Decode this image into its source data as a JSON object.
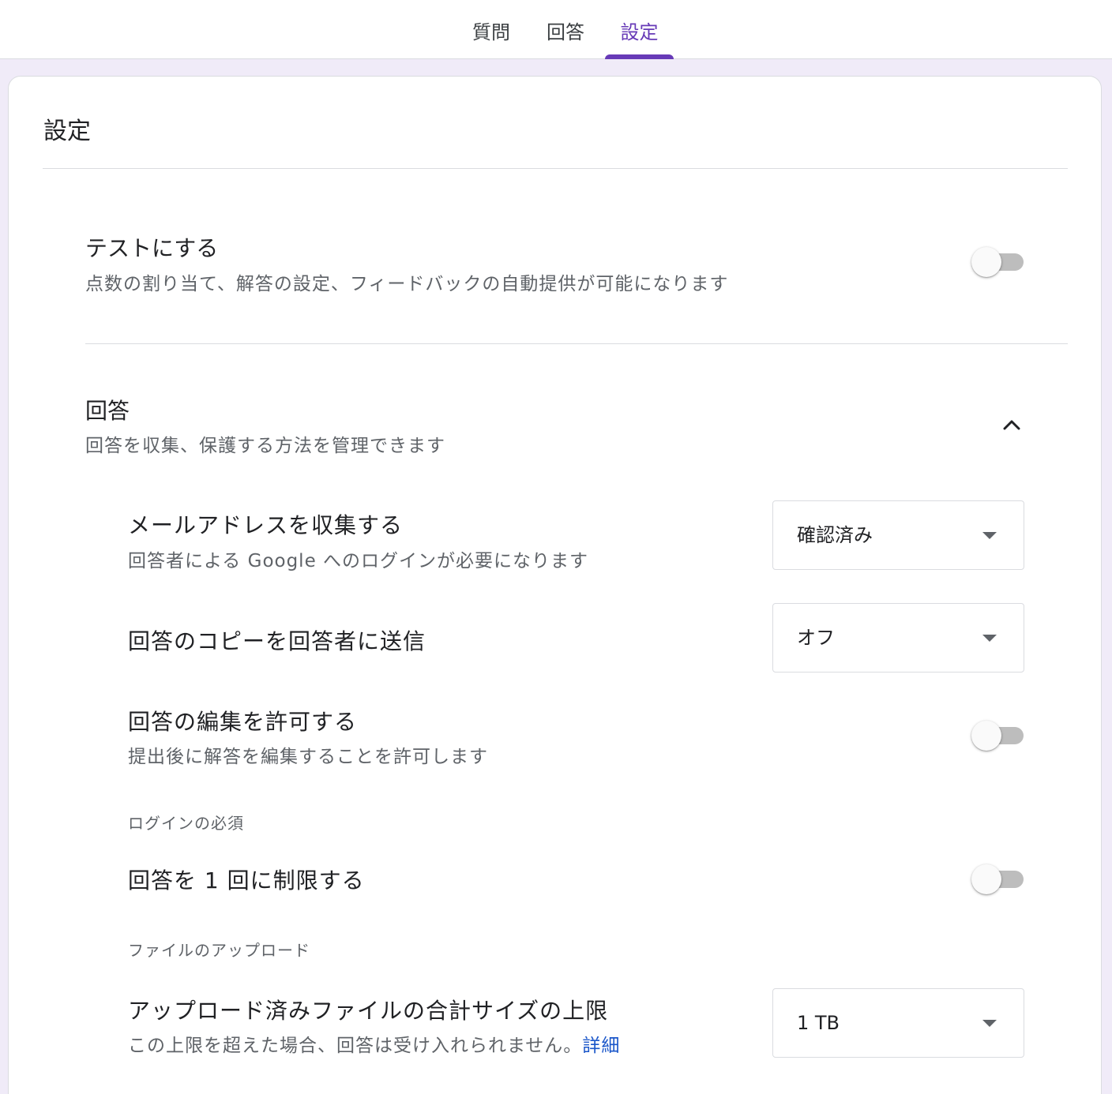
{
  "tabs": [
    {
      "label": "質問",
      "active": false
    },
    {
      "label": "回答",
      "active": false
    },
    {
      "label": "設定",
      "active": true
    }
  ],
  "colors": {
    "accent": "#673ab7",
    "background": "#f0ebf8",
    "link": "#1a56c9"
  },
  "settings": {
    "title": "設定",
    "quiz": {
      "title": "テストにする",
      "description": "点数の割り当て、解答の設定、フィードバックの自動提供が可能になります",
      "enabled": false
    },
    "responses": {
      "title": "回答",
      "description": "回答を収集、保護する方法を管理できます",
      "expanded": true,
      "expand_icon": "chevron-up-icon",
      "collect_email": {
        "title": "メールアドレスを収集する",
        "description": "回答者による Google へのログインが必要になります",
        "selected": "確認済み"
      },
      "send_copy": {
        "title": "回答のコピーを回答者に送信",
        "selected": "オフ"
      },
      "allow_edit": {
        "title": "回答の編集を許可する",
        "description": "提出後に解答を編集することを許可します",
        "enabled": false
      },
      "login_group_label": "ログインの必須",
      "limit_one": {
        "title": "回答を 1 回に制限する",
        "enabled": false
      },
      "upload_group_label": "ファイルのアップロード",
      "upload_limit": {
        "title": "アップロード済みファイルの合計サイズの上限",
        "description": "この上限を超えた場合、回答は受け入れられません。",
        "link_text": "詳細",
        "selected": "1 TB"
      }
    }
  }
}
